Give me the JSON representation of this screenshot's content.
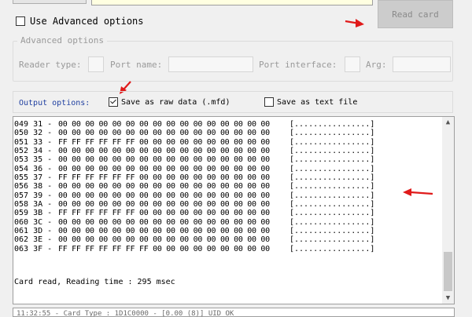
{
  "top": {
    "read_card_label": "Read card"
  },
  "use_advanced": {
    "label": "Use Advanced options",
    "checked": false
  },
  "advanced": {
    "title": "Advanced options",
    "reader_type_label": "Reader type:",
    "port_name_label": "Port name:",
    "port_interface_label": "Port interface:",
    "arg_label": "Arg:"
  },
  "output": {
    "label": "Output options:",
    "raw_data_label": "Save as raw data (.mfd)",
    "raw_data_checked": true,
    "text_file_label": "Save as text file",
    "text_file_checked": false
  },
  "dump": {
    "lines": [
      {
        "addr": "049 31 -",
        "hex": "00 00 00 00 00 00 00 00 00 00 00 00 00 00 00 00",
        "ascii": "[................]"
      },
      {
        "addr": "050 32 -",
        "hex": "00 00 00 00 00 00 00 00 00 00 00 00 00 00 00 00",
        "ascii": "[................]"
      },
      {
        "addr": "051 33 -",
        "hex": "FF FF FF FF FF FF 00 00 00 00 00 00 00 00 00 00",
        "ascii": "[................]"
      },
      {
        "addr": "052 34 -",
        "hex": "00 00 00 00 00 00 00 00 00 00 00 00 00 00 00 00",
        "ascii": "[................]"
      },
      {
        "addr": "053 35 -",
        "hex": "00 00 00 00 00 00 00 00 00 00 00 00 00 00 00 00",
        "ascii": "[................]"
      },
      {
        "addr": "054 36 -",
        "hex": "00 00 00 00 00 00 00 00 00 00 00 00 00 00 00 00",
        "ascii": "[................]"
      },
      {
        "addr": "055 37 -",
        "hex": "FF FF FF FF FF FF 00 00 00 00 00 00 00 00 00 00",
        "ascii": "[................]"
      },
      {
        "addr": "056 38 -",
        "hex": "00 00 00 00 00 00 00 00 00 00 00 00 00 00 00 00",
        "ascii": "[................]"
      },
      {
        "addr": "057 39 -",
        "hex": "00 00 00 00 00 00 00 00 00 00 00 00 00 00 00 00",
        "ascii": "[................]"
      },
      {
        "addr": "058 3A -",
        "hex": "00 00 00 00 00 00 00 00 00 00 00 00 00 00 00 00",
        "ascii": "[................]"
      },
      {
        "addr": "059 3B -",
        "hex": "FF FF FF FF FF FF 00 00 00 00 00 00 00 00 00 00",
        "ascii": "[................]"
      },
      {
        "addr": "060 3C -",
        "hex": "00 00 00 00 00 00 00 00 00 00 00 00 00 00 00 00",
        "ascii": "[................]"
      },
      {
        "addr": "061 3D -",
        "hex": "00 00 00 00 00 00 00 00 00 00 00 00 00 00 00 00",
        "ascii": "[................]"
      },
      {
        "addr": "062 3E -",
        "hex": "00 00 00 00 00 00 00 00 00 00 00 00 00 00 00 00",
        "ascii": "[................]"
      },
      {
        "addr": "063 3F -",
        "hex": "FF FF FF FF FF FF FF 00 00 00 00 00 00 00 00 00",
        "ascii": "[................]"
      }
    ],
    "status": "Card read, Reading time : 295 msec"
  },
  "bottom_log": {
    "text": "11:32:55 - Card Type : 1D1C0000 - [0.00 (8)] UID OK"
  },
  "colors": {
    "arrow": "#e01a1a",
    "output_label": "#1f3fa0"
  },
  "icons": {
    "scroll_up": "chevron-up-icon",
    "scroll_down": "chevron-down-icon",
    "annotation_arrow": "red-arrow-icon"
  }
}
